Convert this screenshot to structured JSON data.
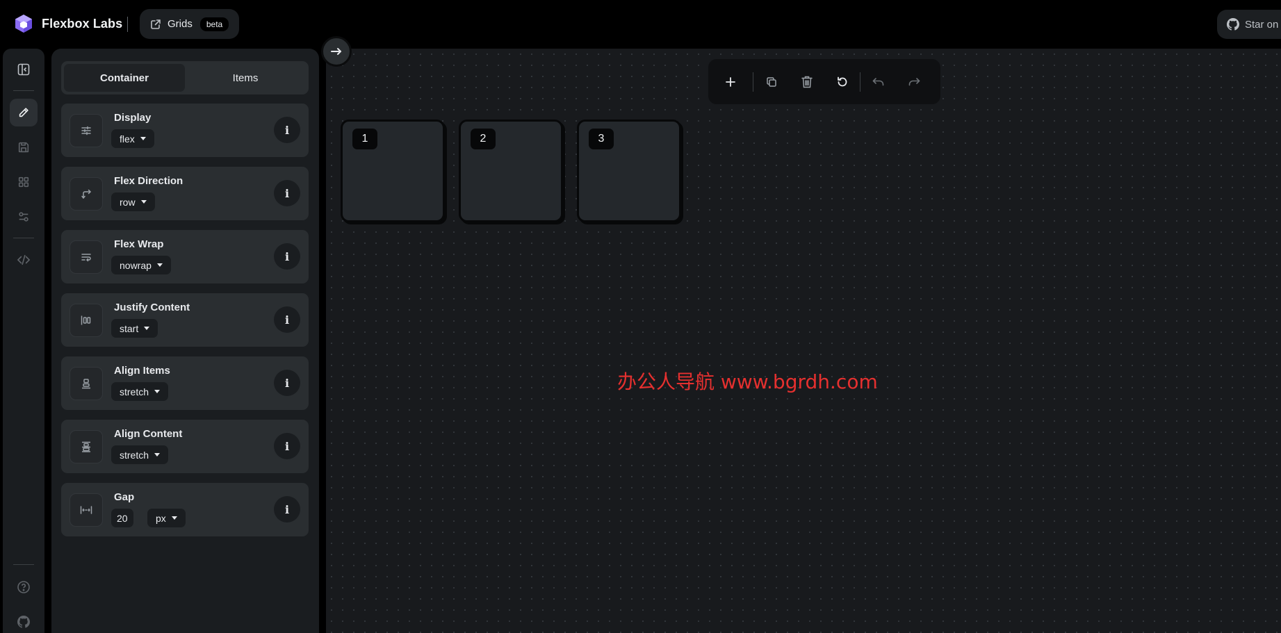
{
  "app": {
    "brand": "Flexbox Labs",
    "grids_label": "Grids",
    "beta_label": "beta",
    "star_label": "Star on"
  },
  "rail": {
    "icons": [
      "sidebar-toggle-icon",
      "pencil-icon",
      "save-icon",
      "grid-icon",
      "sliders-icon",
      "code-icon",
      "help-icon",
      "github-icon"
    ]
  },
  "panel": {
    "tabs": [
      {
        "label": "Container",
        "active": true
      },
      {
        "label": "Items",
        "active": false
      }
    ],
    "properties": [
      {
        "title": "Display",
        "value": "flex",
        "icon": "display-icon"
      },
      {
        "title": "Flex Direction",
        "value": "row",
        "icon": "direction-icon"
      },
      {
        "title": "Flex Wrap",
        "value": "nowrap",
        "icon": "wrap-icon"
      },
      {
        "title": "Justify Content",
        "value": "start",
        "icon": "justify-icon"
      },
      {
        "title": "Align Items",
        "value": "stretch",
        "icon": "align-items-icon"
      },
      {
        "title": "Align Content",
        "value": "stretch",
        "icon": "align-content-icon"
      },
      {
        "title": "Gap",
        "value": "20",
        "unit": "px",
        "icon": "gap-icon"
      }
    ],
    "info_glyph": "i"
  },
  "toolbar": {
    "icons": [
      "plus-icon",
      "copy-icon",
      "trash-icon",
      "reset-icon",
      "undo-icon",
      "redo-icon"
    ]
  },
  "canvas": {
    "items": [
      "1",
      "2",
      "3"
    ]
  },
  "watermark": "办公人导航  www.bgrdh.com",
  "colors": {
    "accent": "#8b6cf5",
    "background": "#000000",
    "panel": "#1a1d20",
    "card": "#2a2e31",
    "watermark": "#e5302f"
  }
}
